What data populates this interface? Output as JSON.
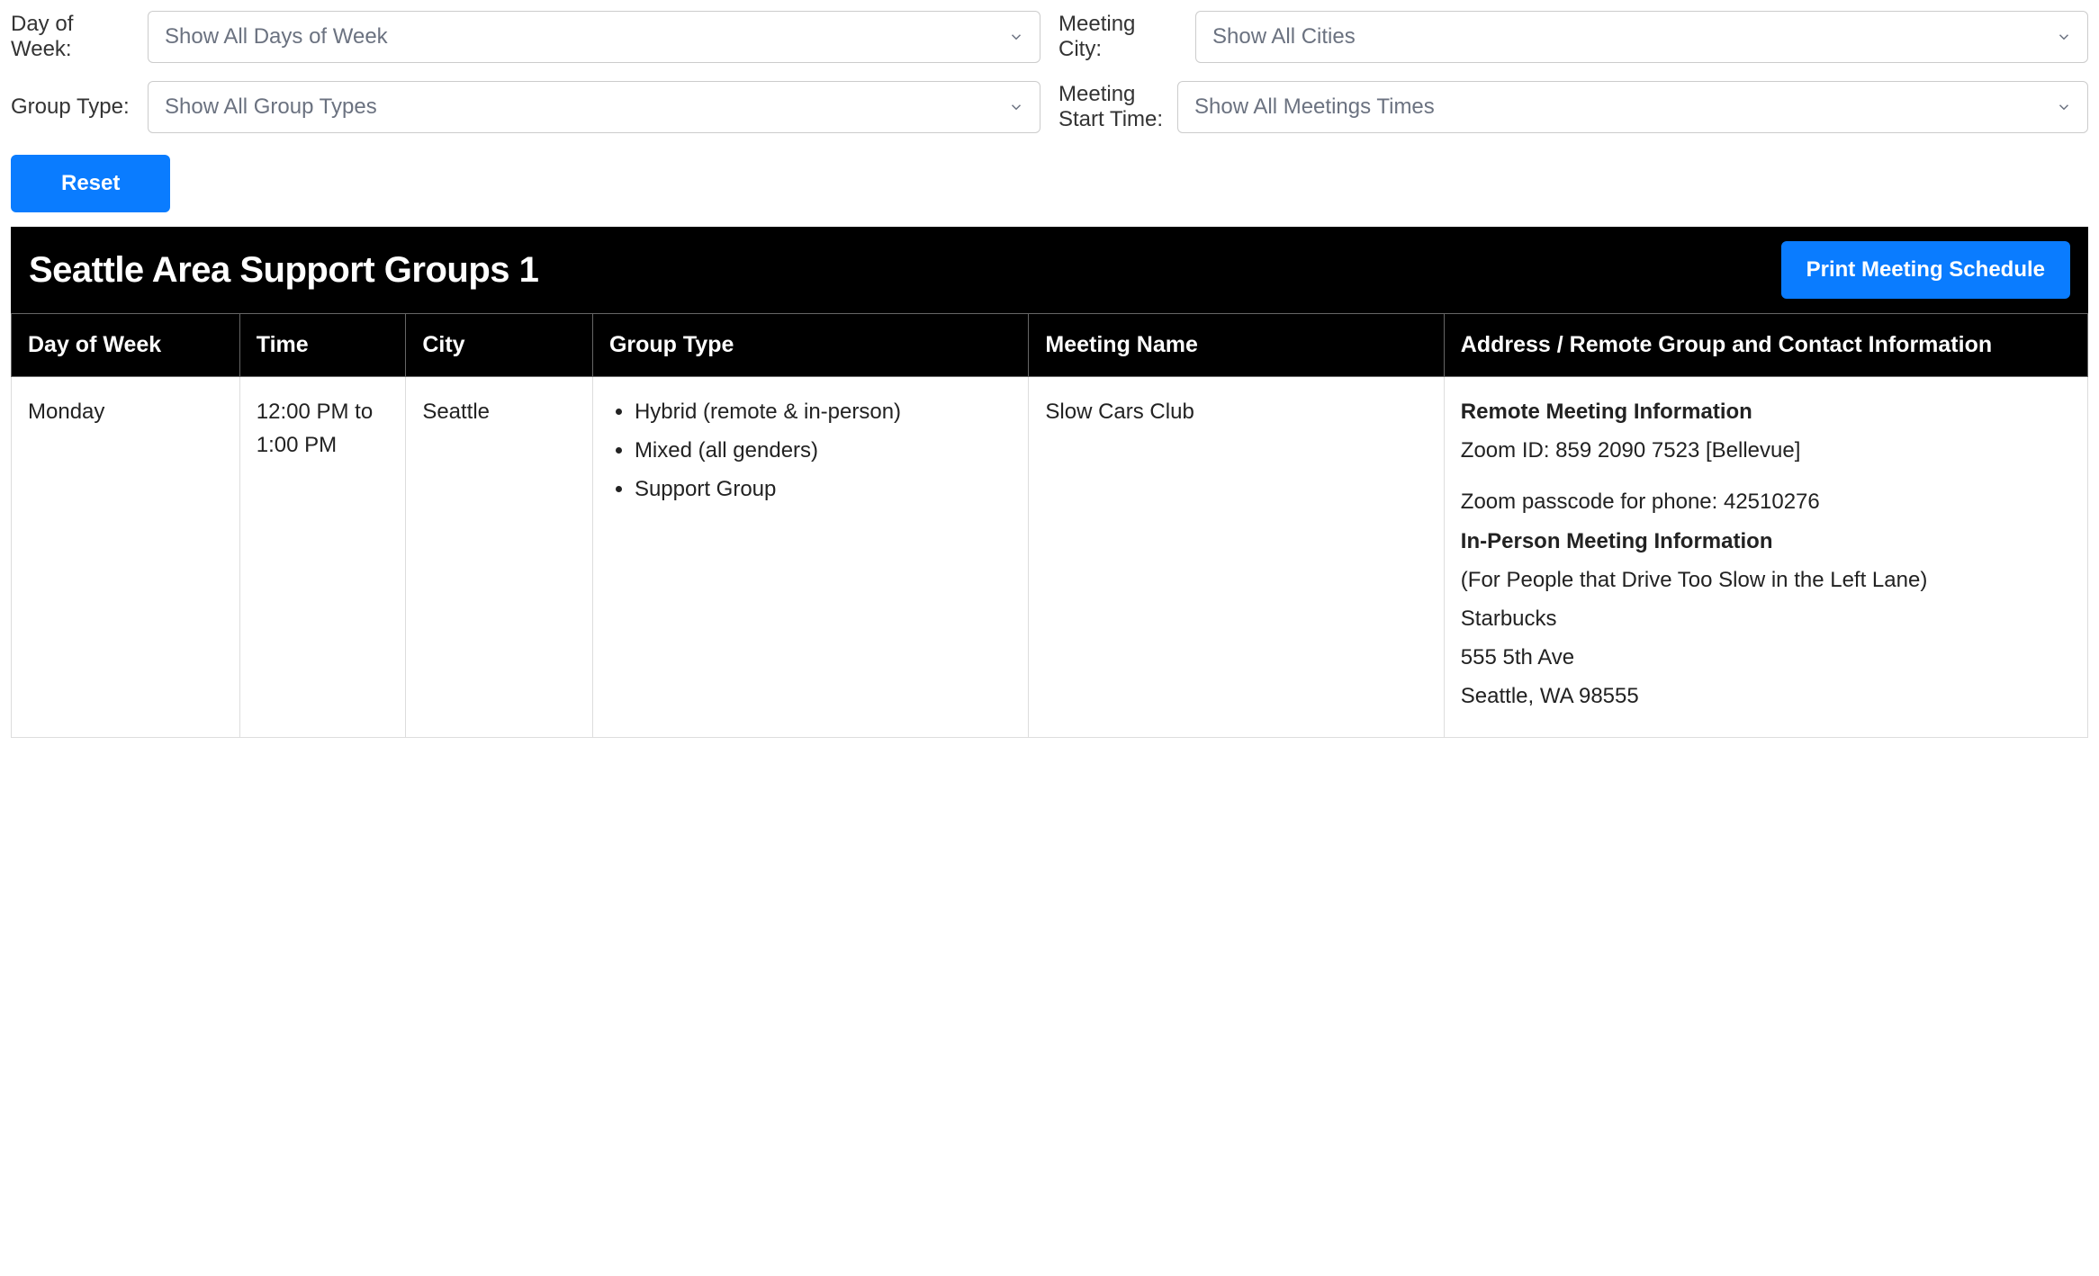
{
  "filters": {
    "day_of_week": {
      "label": "Day of Week:",
      "value": "Show All Days of Week"
    },
    "group_type": {
      "label": "Group Type:",
      "value": "Show All Group Types"
    },
    "meeting_city": {
      "label": "Meeting City:",
      "value": "Show All Cities"
    },
    "meeting_time": {
      "label": "Meeting Start Time:",
      "value": "Show All Meetings Times"
    }
  },
  "buttons": {
    "reset": "Reset",
    "print": "Print Meeting Schedule"
  },
  "panel": {
    "title": "Seattle Area Support Groups 1"
  },
  "table": {
    "headers": {
      "day": "Day of Week",
      "time": "Time",
      "city": "City",
      "group_type": "Group Type",
      "meeting_name": "Meeting Name",
      "address": "Address / Remote Group and Contact Information"
    },
    "rows": [
      {
        "day": "Monday",
        "time": "12:00 PM to 1:00 PM",
        "city": "Seattle",
        "group_types": [
          "Hybrid (remote & in-person)",
          "Mixed (all genders)",
          "Support Group"
        ],
        "meeting_name": "Slow Cars Club",
        "remote_heading": "Remote Meeting Information",
        "remote_line1": "Zoom ID: 859 2090 7523 [Bellevue]",
        "remote_line2": "Zoom passcode for phone: 42510276",
        "inperson_heading": "In-Person Meeting Information",
        "inperson_note": "(For People that Drive Too Slow in the Left Lane)",
        "inperson_venue": "Starbucks",
        "inperson_street": "555 5th Ave",
        "inperson_citystate": "Seattle, WA 98555"
      }
    ]
  }
}
